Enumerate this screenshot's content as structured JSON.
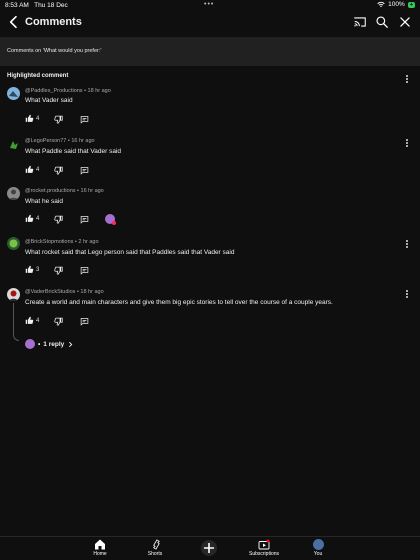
{
  "status": {
    "time": "8:53 AM",
    "date": "Thu 18 Dec",
    "battery_pct": "100%",
    "battery_badge": "+"
  },
  "header": {
    "title": "Comments"
  },
  "banner": {
    "text": "Comments on 'What would you prefer:'"
  },
  "section": {
    "label": "Highlighted comment"
  },
  "comments": [
    {
      "handle": "@Paddles_Productions",
      "age": "18 hr ago",
      "meta": "@Paddles_Productions • 18 hr ago",
      "text": "What Vader said",
      "likes": "4"
    },
    {
      "handle": "@LegoPerson77",
      "age": "16 hr ago",
      "meta": "@LegoPerson77 • 16 hr ago",
      "text": "What Paddle said that Vader said",
      "likes": "4"
    },
    {
      "handle": "@rocket.productions",
      "age": "16 hr ago",
      "meta": "@rocket.productions • 16 hr ago",
      "text": "What he said",
      "likes": "4"
    },
    {
      "handle": "@BrickStopmotions",
      "age": "2 hr ago",
      "meta": "@BrickStopmotions • 2 hr ago",
      "text": "What rocket said that Lego person said that Paddles said that Vader said",
      "likes": "3"
    },
    {
      "handle": "@VaderBrickStudios",
      "age": "18 hr ago",
      "meta": "@VaderBrickStudios • 18 hr ago",
      "text": "Create a world and main characters and give them big epic stories to tell over the course of a couple years.",
      "likes": "4"
    }
  ],
  "replies": {
    "separator": "•",
    "label": "1 reply"
  },
  "nav": {
    "home": "Home",
    "shorts": "Shorts",
    "subscriptions": "Subscriptions",
    "you": "You"
  },
  "colors": {
    "background": "#0f0f0f",
    "banner": "#212121",
    "accent_blue": "#3ea6ff",
    "battery_green": "#34c759"
  },
  "icons": [
    "back-arrow-icon",
    "cast-icon",
    "search-icon",
    "more-vert-icon",
    "thumb-up-icon",
    "thumb-down-icon",
    "reply-icon",
    "home-icon",
    "shorts-icon",
    "create-icon",
    "subscriptions-icon"
  ]
}
